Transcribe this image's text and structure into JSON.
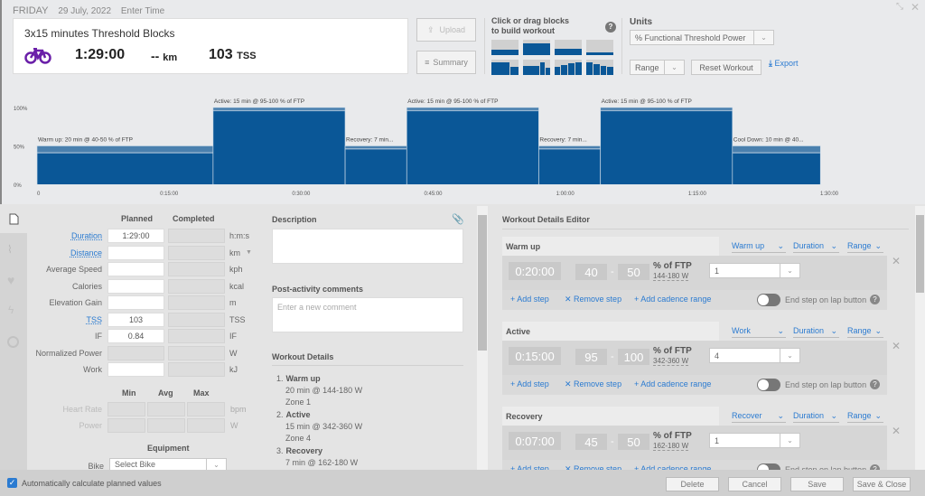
{
  "header": {
    "day": "FRIDAY",
    "date": "29 July, 2022",
    "time_placeholder": "Enter Time"
  },
  "summary_card": {
    "title": "3x15 minutes Threshold Blocks",
    "sport_icon": "bike-icon",
    "sport_color": "#6a1fa8",
    "duration": "1:29:00",
    "distance": "--",
    "distance_unit": "km",
    "tss": "103",
    "tss_unit": "TSS"
  },
  "buttons": {
    "upload": "Upload",
    "summary": "Summary",
    "reset": "Reset Workout",
    "export": "Export"
  },
  "builder": {
    "hint_line1": "Click or drag blocks",
    "hint_line2": "to build workout"
  },
  "units": {
    "label": "Units",
    "selected": "% Functional Threshold Power",
    "range_selected": "Range"
  },
  "chart_data": {
    "type": "bar",
    "xlabel": "",
    "ylabel": "",
    "y_ticks": [
      "100%",
      "50%",
      "0%"
    ],
    "y_range": [
      0,
      110
    ],
    "x_ticks": [
      "0",
      "0:15:00",
      "0:30:00",
      "0:45:00",
      "1:00:00",
      "1:15:00",
      "1:30:00"
    ],
    "x_range_min": [
      0,
      90
    ],
    "accent": "#0a5797",
    "band": "#4a80ae",
    "steps": [
      {
        "label": "Warm up: 20 min @ 40-50 % of FTP",
        "start": 0,
        "duration": 20,
        "low": 40,
        "high": 50
      },
      {
        "label": "Active: 15 min @ 95-100 % of FTP",
        "start": 20,
        "duration": 15,
        "low": 95,
        "high": 100
      },
      {
        "label": "Recovery: 7 min...",
        "start": 35,
        "duration": 7,
        "low": 45,
        "high": 50
      },
      {
        "label": "Active: 15 min @ 95-100 % of FTP",
        "start": 42,
        "duration": 15,
        "low": 95,
        "high": 100
      },
      {
        "label": "Recovery: 7 min...",
        "start": 57,
        "duration": 7,
        "low": 45,
        "high": 50
      },
      {
        "label": "Active: 15 min @ 95-100 % of FTP",
        "start": 64,
        "duration": 15,
        "low": 95,
        "high": 100
      },
      {
        "label": "Cool Down: 10 min @ 40...",
        "start": 79,
        "duration": 10,
        "low": 40,
        "high": 50
      }
    ]
  },
  "form": {
    "planned": "Planned",
    "completed": "Completed",
    "rows": [
      {
        "label": "Duration",
        "value": "1:29:00",
        "unit": "h:m:s",
        "link": true
      },
      {
        "label": "Distance",
        "value": "",
        "unit": "km",
        "link": true
      },
      {
        "label": "Average Speed",
        "value": "",
        "unit": "kph"
      },
      {
        "label": "Calories",
        "value": "",
        "unit": "kcal"
      },
      {
        "label": "Elevation Gain",
        "value": "",
        "unit": "m"
      },
      {
        "label": "TSS",
        "value": "103",
        "unit": "TSS",
        "link": true
      },
      {
        "label": "IF",
        "value": "0.84",
        "unit": "IF"
      },
      {
        "label": "Normalized Power",
        "value": "",
        "unit": "W",
        "disabled": true
      },
      {
        "label": "Work",
        "value": "",
        "unit": "kJ"
      }
    ],
    "min": "Min",
    "avg": "Avg",
    "max": "Max",
    "hr_label": "Heart Rate",
    "hr_unit": "bpm",
    "power_label": "Power",
    "power_unit": "W",
    "equipment": "Equipment",
    "bike_label": "Bike",
    "bike_placeholder": "Select Bike"
  },
  "middle": {
    "description": "Description",
    "comments": "Post-activity comments",
    "comment_placeholder": "Enter a new comment",
    "details_title": "Workout Details",
    "details": [
      {
        "num": "1.",
        "name": "Warm up",
        "lines": [
          "20 min @ 144-180 W",
          "Zone 1"
        ]
      },
      {
        "num": "2.",
        "name": "Active",
        "lines": [
          "15 min @ 342-360 W",
          "Zone 4"
        ]
      },
      {
        "num": "3.",
        "name": "Recovery",
        "lines": [
          "7 min @ 162-180 W"
        ]
      }
    ]
  },
  "editor": {
    "title": "Workout Details Editor",
    "add_step": "Add step",
    "remove_step": "Remove step",
    "add_cadence": "Add cadence range",
    "lap": "End step on lap button",
    "unit": "% of FTP",
    "duration_dd": "Duration",
    "range_dd": "Range",
    "blocks": [
      {
        "name": "Warm up",
        "type": "Warm up",
        "time": "0:20:00",
        "low": "40",
        "high": "50",
        "watts": "144-180 W",
        "zone": "1"
      },
      {
        "name": "Active",
        "type": "Work",
        "time": "0:15:00",
        "low": "95",
        "high": "100",
        "watts": "342-360 W",
        "zone": "4"
      },
      {
        "name": "Recovery",
        "type": "Recover",
        "time": "0:07:00",
        "low": "45",
        "high": "50",
        "watts": "162-180 W",
        "zone": "1"
      }
    ]
  },
  "footer": {
    "auto_calc": "Automatically calculate planned values",
    "auto_calc_checked": true,
    "delete": "Delete",
    "cancel": "Cancel",
    "save": "Save",
    "save_close": "Save & Close"
  }
}
